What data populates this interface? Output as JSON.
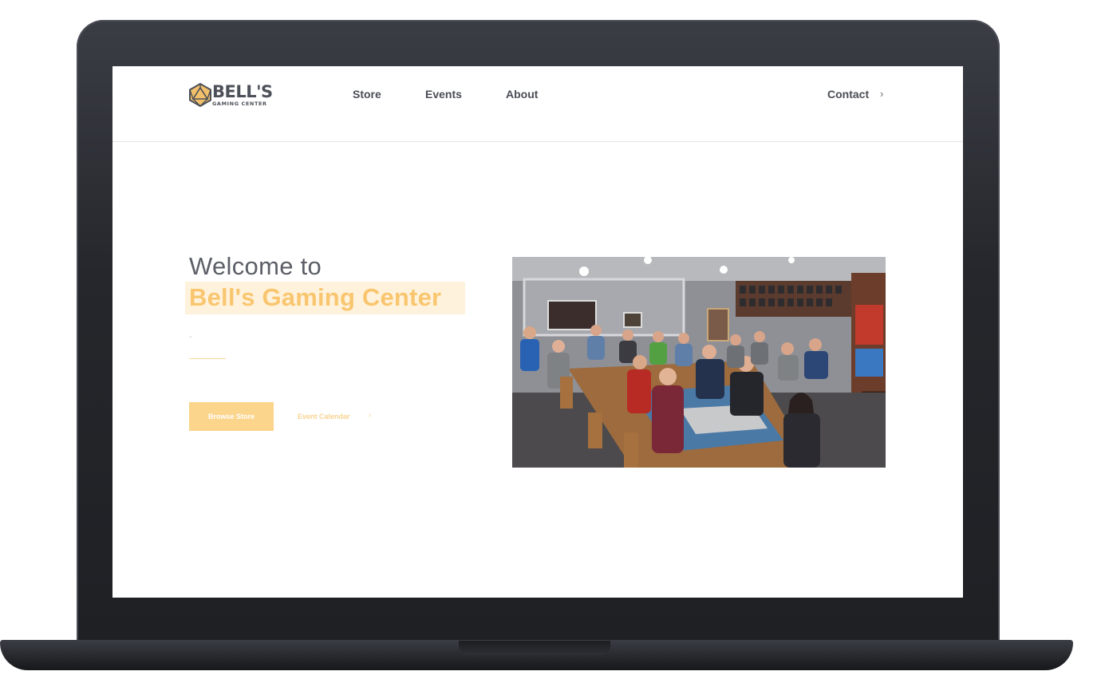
{
  "site": {
    "logo": {
      "wordmark": "BELL'S",
      "subline": "GAMING CENTER"
    },
    "nav": {
      "store": "Store",
      "events": "Events",
      "about": "About",
      "contact": "Contact",
      "contact_chevron": "›"
    }
  },
  "hero": {
    "heading_line1": "Welcome to",
    "heading_line2": "Bell's Gaming Center",
    "subtext": "-",
    "primary_button": "Browse Store",
    "secondary_link": "Event Calendar",
    "secondary_chevron": "›",
    "image_subject": "group of gamers playing at tables in the store"
  },
  "colors": {
    "accent": "#f9c66f",
    "accent_highlight": "#fff2dc",
    "button_bg": "#fcd58d",
    "nav_text": "#4a4d55",
    "frame": "#25272c"
  }
}
